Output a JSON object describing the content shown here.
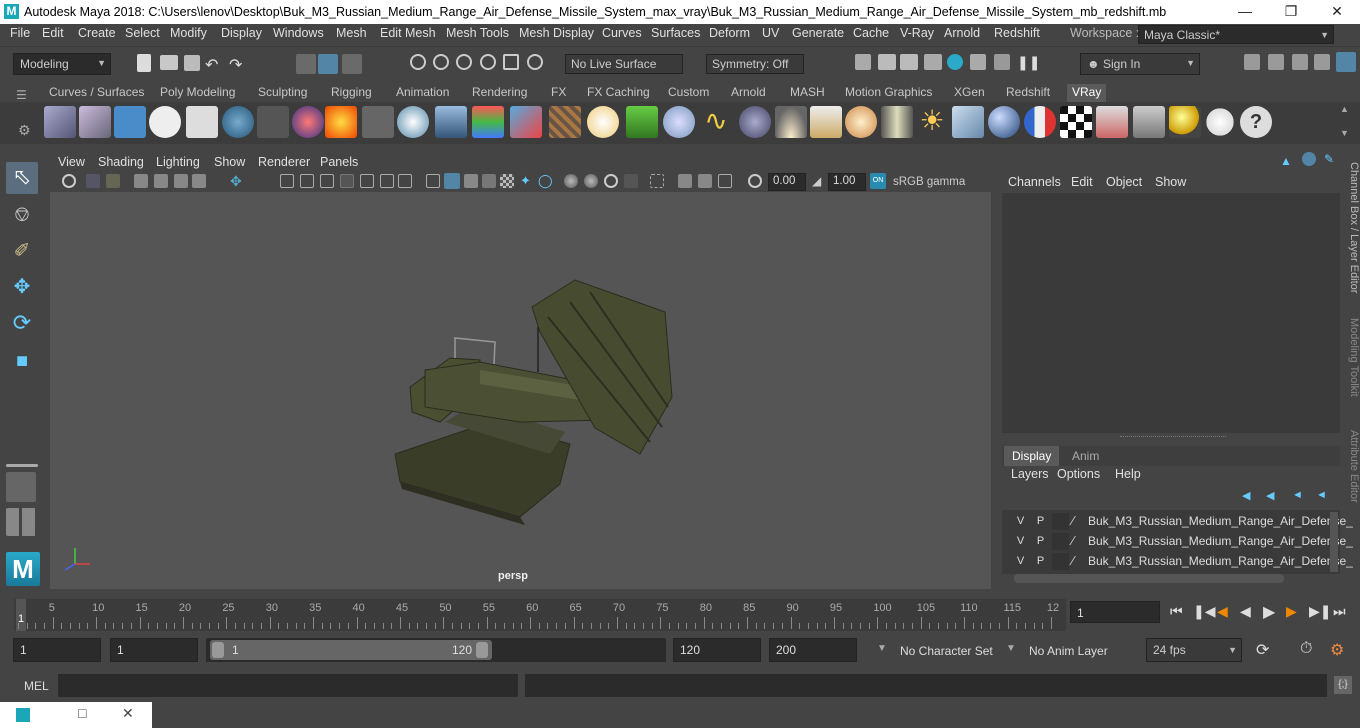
{
  "window": {
    "title": "Autodesk Maya 2018: C:\\Users\\lenov\\Desktop\\Buk_M3_Russian_Medium_Range_Air_Defense_Missile_System_max_vray\\Buk_M3_Russian_Medium_Range_Air_Defense_Missile_System_mb_redshift.mb",
    "app_icon": "M"
  },
  "menubar": {
    "items": [
      "File",
      "Edit",
      "Create",
      "Select",
      "Modify",
      "Display",
      "Windows",
      "Mesh",
      "Edit Mesh",
      "Mesh Tools",
      "Mesh Display",
      "Curves",
      "Surfaces",
      "Deform",
      "UV",
      "Generate",
      "Cache",
      "V-Ray",
      "Arnold",
      "Redshift"
    ],
    "workspace_label": "Workspace :",
    "workspace_value": "Maya Classic*"
  },
  "statusline": {
    "mode": "Modeling",
    "live_surface": "No Live Surface",
    "symmetry": "Symmetry: Off",
    "sign_in": "Sign In"
  },
  "shelf": {
    "tabs": [
      "Curves / Surfaces",
      "Poly Modeling",
      "Sculpting",
      "Rigging",
      "Animation",
      "Rendering",
      "FX",
      "FX Caching",
      "Custom",
      "Arnold",
      "MASH",
      "Motion Graphics",
      "XGen",
      "Redshift",
      "VRay"
    ],
    "active_tab": "VRay"
  },
  "viewport": {
    "menu": [
      "View",
      "Shading",
      "Lighting",
      "Show",
      "Renderer",
      "Panels"
    ],
    "near_value": "0.00",
    "far_value": "1.00",
    "color_space": "sRGB gamma",
    "camera_label": "persp"
  },
  "channelbox": {
    "menu": [
      "Channels",
      "Edit",
      "Object",
      "Show"
    ]
  },
  "layereditor": {
    "tabs": [
      "Display",
      "Anim"
    ],
    "active_tab": "Display",
    "menu": [
      "Layers",
      "Options",
      "Help"
    ],
    "layers": [
      {
        "v": "V",
        "p": "P",
        "name": "Buk_M3_Russian_Medium_Range_Air_Defense_"
      },
      {
        "v": "V",
        "p": "P",
        "name": "Buk_M3_Russian_Medium_Range_Air_Defense_"
      },
      {
        "v": "V",
        "p": "P",
        "name": "Buk_M3_Russian_Medium_Range_Air_Defense_"
      }
    ]
  },
  "side_tabs": [
    "Channel Box / Layer Editor",
    "Modeling Toolkit",
    "Attribute Editor"
  ],
  "timeline": {
    "ticks": [
      "5",
      "10",
      "15",
      "20",
      "25",
      "30",
      "35",
      "40",
      "45",
      "50",
      "55",
      "60",
      "65",
      "70",
      "75",
      "80",
      "85",
      "90",
      "95",
      "100",
      "105",
      "110",
      "115",
      "12"
    ],
    "current_frame_marker": "1",
    "current_frame": "1"
  },
  "range": {
    "start": "1",
    "playback_start": "1",
    "slider_start": "1",
    "slider_end": "120",
    "playback_end": "120",
    "end": "200",
    "character_set": "No Character Set",
    "anim_layer": "No Anim Layer",
    "fps": "24 fps"
  },
  "cmdline": {
    "label": "MEL"
  },
  "colors": {
    "accent": "#5285a6",
    "bg": "#444444",
    "field": "#2b2b2b"
  }
}
